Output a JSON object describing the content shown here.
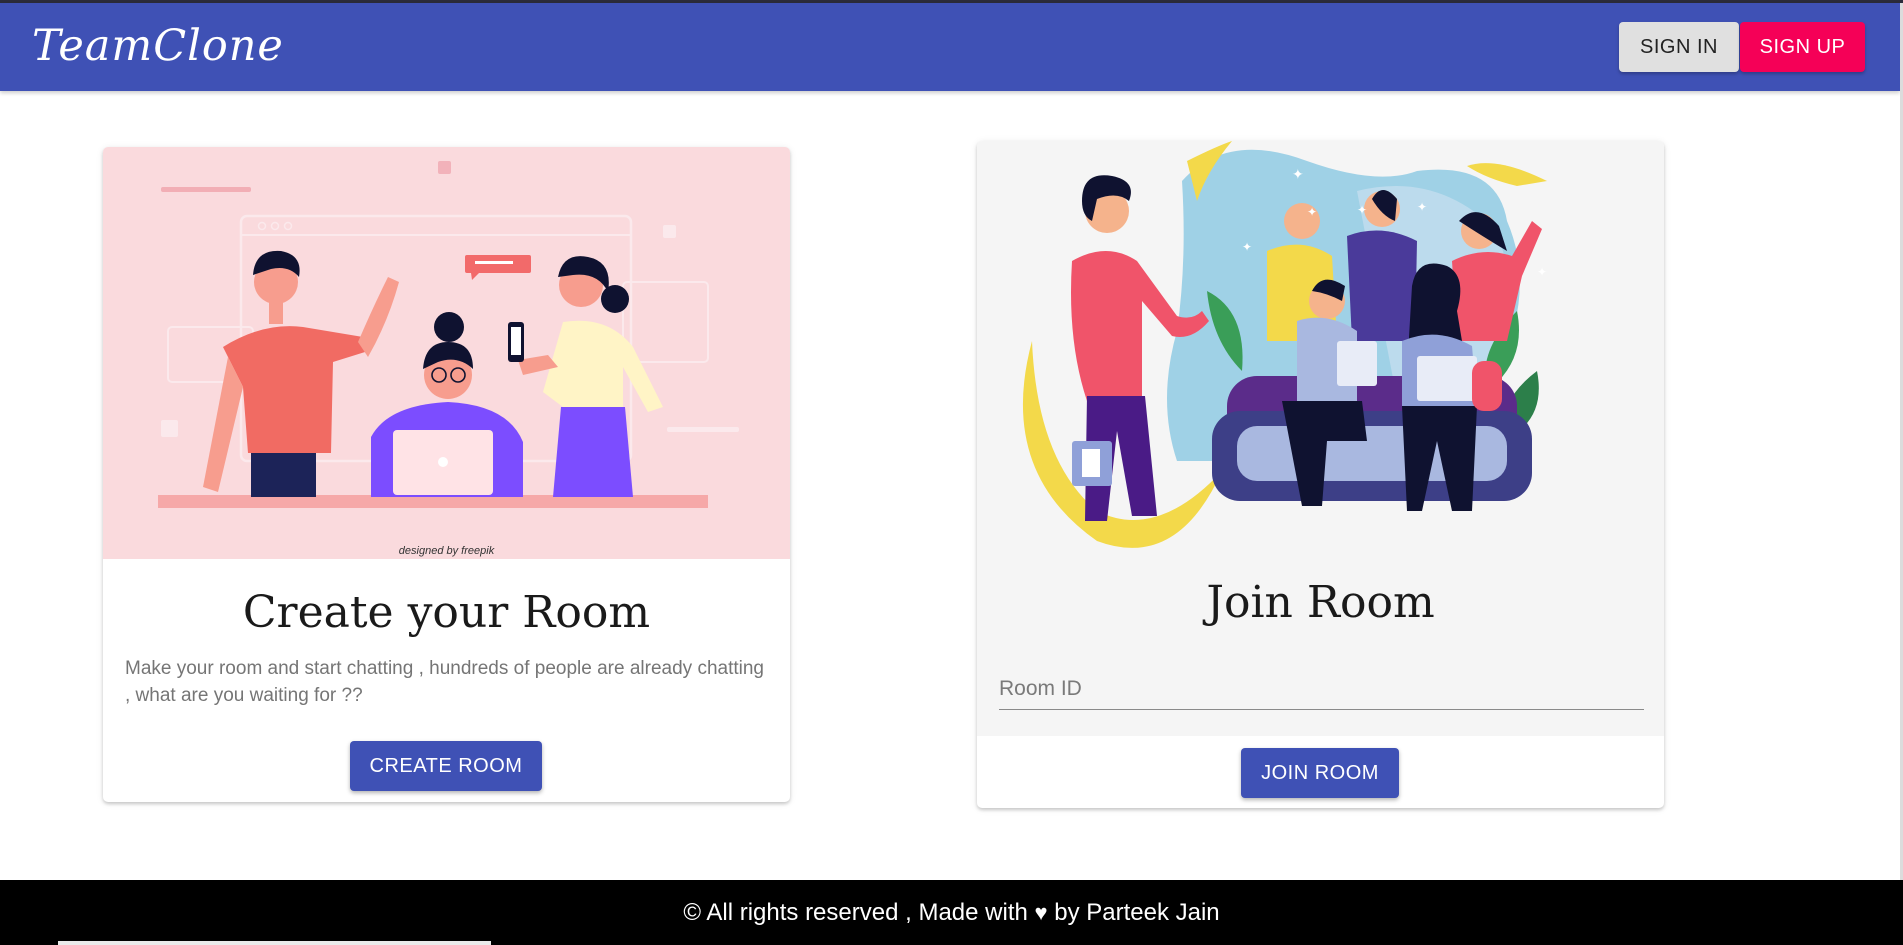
{
  "header": {
    "logo_text": "TeamClone",
    "signin_label": "SIGN IN",
    "signup_label": "SIGN UP"
  },
  "create_card": {
    "illustration_credit": "designed by freepik",
    "title": "Create your Room",
    "description": "Make your room and start chatting , hundreds of people are already chatting , what are you waiting for ??",
    "button_label": "CREATE ROOM"
  },
  "join_card": {
    "title": "Join Room",
    "input_placeholder": "Room ID",
    "input_value": "",
    "button_label": "JOIN ROOM"
  },
  "footer": {
    "text_before_heart": "© All rights reserved , Made with",
    "heart_icon": "♥",
    "text_after_heart": "by Parteek Jain"
  },
  "colors": {
    "primary": "#3f51b5",
    "secondary": "#f50057",
    "footer_bg": "#000000",
    "create_media_bg": "#fadadd"
  }
}
